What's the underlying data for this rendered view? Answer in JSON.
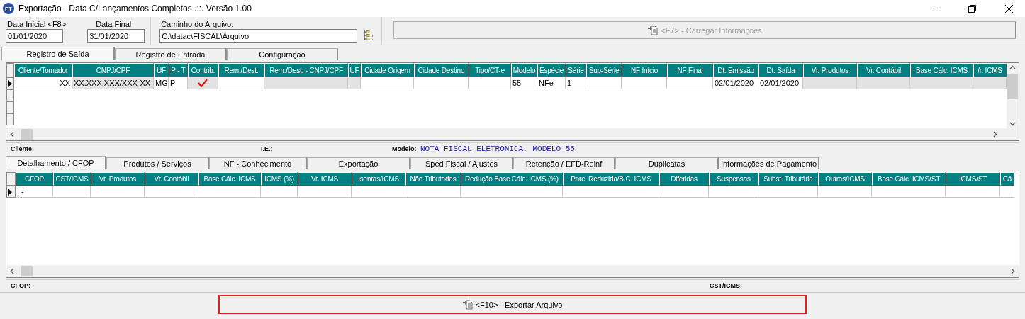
{
  "window": {
    "icon_text": "FT",
    "title": "Exportação - Data C/Lançamentos Completos .::. Versão 1.00"
  },
  "filters": {
    "start_date": {
      "label": "Data Inicial <F8>",
      "value": "01/01/2020"
    },
    "end_date": {
      "label": "Data Final",
      "value": "31/01/2020"
    },
    "file_path": {
      "label": "Caminho do Arquivo:",
      "value": "C:\\datac\\FISCAL\\Arquivo"
    },
    "load_button": {
      "label": "<F7> - Carregar Informações",
      "disabled": true
    }
  },
  "main_tabs": [
    {
      "label": "Registro de Saída",
      "selected": true
    },
    {
      "label": "Registro de Entrada",
      "selected": false
    },
    {
      "label": "Configuração",
      "selected": false
    }
  ],
  "records_table": {
    "columns": [
      {
        "label": "Cliente/Tomador",
        "shaded": false
      },
      {
        "label": "CNPJ/CPF",
        "shaded": true
      },
      {
        "label": "UF",
        "shaded": false
      },
      {
        "label": "P - T",
        "shaded": false
      },
      {
        "label": "Contrib.",
        "shaded": true
      },
      {
        "label": "Rem./Dest.",
        "shaded": false
      },
      {
        "label": "Rem./Dest. - CNPJ/CPF",
        "shaded": true
      },
      {
        "label": "UF",
        "shaded": true
      },
      {
        "label": "Cidade Origem",
        "shaded": false
      },
      {
        "label": "Cidade Destino",
        "shaded": false
      },
      {
        "label": "Tipo/CT-e",
        "shaded": false
      },
      {
        "label": "Modelo",
        "shaded": false
      },
      {
        "label": "Espécie",
        "shaded": false
      },
      {
        "label": "Série",
        "shaded": false
      },
      {
        "label": "Sub-Série",
        "shaded": false
      },
      {
        "label": "NF Início",
        "shaded": false
      },
      {
        "label": "NF Final",
        "shaded": false
      },
      {
        "label": "Dt. Emissão",
        "shaded": false
      },
      {
        "label": "Dt. Saída",
        "shaded": false
      },
      {
        "label": "Vr. Produtos",
        "shaded": true
      },
      {
        "label": "Vr. Contábil",
        "shaded": true
      },
      {
        "label": "Base Cálc. ICMS",
        "shaded": true
      },
      {
        "label": "/r. ICMS",
        "shaded": true
      }
    ],
    "rows": [
      {
        "current": true,
        "contrib_checked": true,
        "cells": [
          "XX",
          "XX.XXX.XXX/XXX-XX",
          "MG",
          "P",
          null,
          null,
          null,
          null,
          null,
          null,
          null,
          "55",
          "NFe",
          "1",
          null,
          null,
          null,
          "02/01/2020",
          "02/01/2020",
          null,
          null,
          null,
          null
        ]
      }
    ]
  },
  "record_info": {
    "client_label": "Cliente:",
    "ie_label": "I.E.:",
    "model_label": "Modelo:",
    "model_value": "NOTA FISCAL ELETRONICA, MODELO 55"
  },
  "detail_tabs": [
    {
      "label": "Detalhamento / CFOP",
      "selected": true
    },
    {
      "label": "Produtos / Serviços",
      "selected": false
    },
    {
      "label": "NF - Conhecimento",
      "selected": false
    },
    {
      "label": "Exportação",
      "selected": false
    },
    {
      "label": "Sped Fiscal / Ajustes",
      "selected": false
    },
    {
      "label": "Retenção / EFD-Reinf",
      "selected": false
    },
    {
      "label": "Duplicatas",
      "selected": false
    },
    {
      "label": "Informações de Pagamento",
      "selected": false
    }
  ],
  "detail_table": {
    "columns": [
      "CFOP",
      "CST/ICMS",
      "Vr. Produtos",
      "Vr. Contábil",
      "Base Cálc. ICMS",
      "ICMS (%)",
      "Vr. ICMS",
      "Isentas/ICMS",
      "Não Tributadas",
      "Redução Base Cálc. ICMS (%)",
      "Parc. Reduzida/B.C. ICMS",
      "Diferidas",
      "Suspensas",
      "Subst. Tributária",
      "Outras/ICMS",
      "Base Cálc. ICMS/ST",
      "ICMS/ST",
      "Cá"
    ],
    "rows": [
      {
        "current": true,
        "cells": [
          ". -",
          null,
          null,
          null,
          null,
          null,
          null,
          null,
          null,
          null,
          null,
          null,
          null,
          null,
          null,
          null,
          null,
          null
        ]
      }
    ]
  },
  "detail_info": {
    "cfop_label": "CFOP:",
    "cst_label": "CST/ICMS:"
  },
  "export_button": {
    "label": "<F10> - Exportar Arquivo",
    "highlighted": true
  }
}
